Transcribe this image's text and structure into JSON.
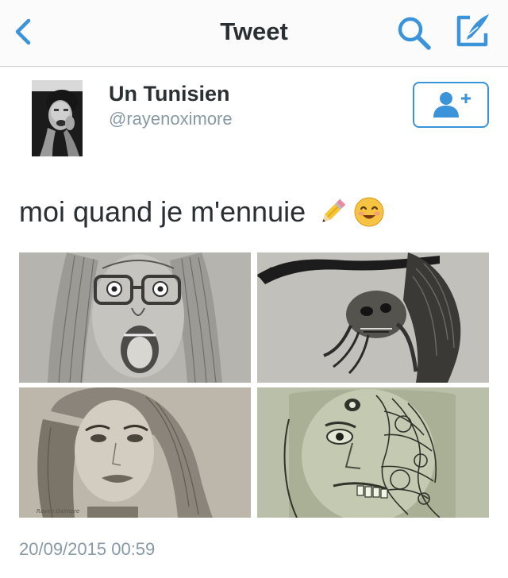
{
  "navbar": {
    "title": "Tweet",
    "icons": [
      "chevron-left-icon",
      "search-icon",
      "compose-icon"
    ]
  },
  "accent_color": "#3b94d9",
  "tweet": {
    "author": {
      "display_name": "Un Tunisien",
      "handle": "@rayenoximore"
    },
    "text": "moi quand je m'ennuie",
    "emojis": [
      "pencil-emoji",
      "smiling-face-emoji"
    ],
    "photos": [
      {
        "subject": "pencil drawing of screaming girl with glasses"
      },
      {
        "subject": "pencil drawing of horned skeletal creature"
      },
      {
        "subject": "pencil drawing of woman portrait"
      },
      {
        "subject": "ink drawing of half-mechanical face"
      }
    ],
    "photo_signature": "Rayen Oximore",
    "timestamp": "20/09/2015 00:59"
  }
}
